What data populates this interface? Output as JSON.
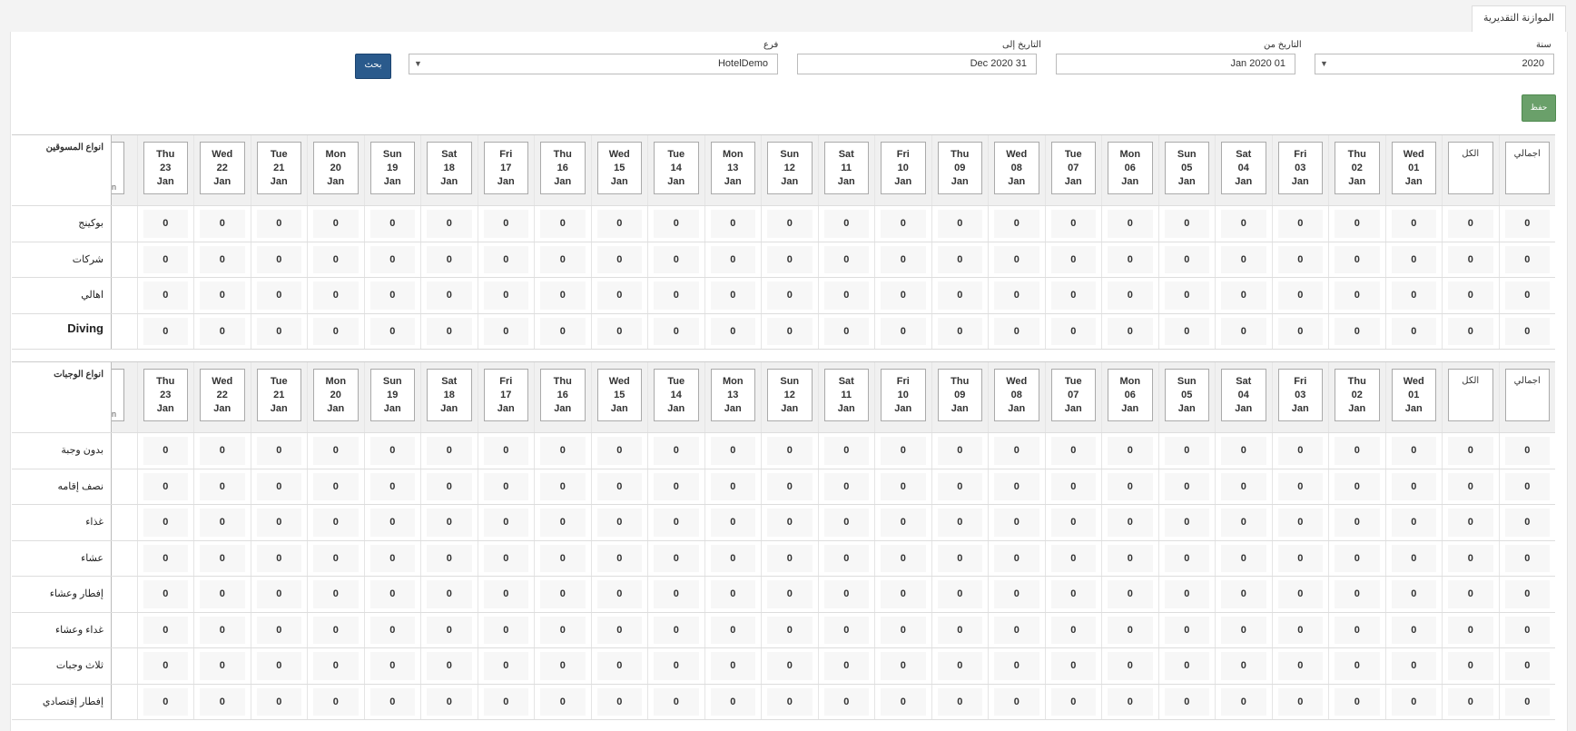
{
  "tab": {
    "title": "الموازنة التقديرية"
  },
  "filters": {
    "year": {
      "label": "سنة",
      "value": "2020"
    },
    "date_from": {
      "label": "التاريخ من",
      "value": "Jan 2020 01"
    },
    "date_to": {
      "label": "التاريخ إلى",
      "value": "Dec 2020 31"
    },
    "branch": {
      "label": "فرع",
      "value": "HotelDemo"
    },
    "search_label": "بحث"
  },
  "save_label": "حفظ",
  "columns": {
    "total": "اجمالي",
    "all": "الكل",
    "days": [
      {
        "dow": "Wed",
        "day": "01",
        "mon": "Jan"
      },
      {
        "dow": "Thu",
        "day": "02",
        "mon": "Jan"
      },
      {
        "dow": "Fri",
        "day": "03",
        "mon": "Jan"
      },
      {
        "dow": "Sat",
        "day": "04",
        "mon": "Jan"
      },
      {
        "dow": "Sun",
        "day": "05",
        "mon": "Jan"
      },
      {
        "dow": "Mon",
        "day": "06",
        "mon": "Jan"
      },
      {
        "dow": "Tue",
        "day": "07",
        "mon": "Jan"
      },
      {
        "dow": "Wed",
        "day": "08",
        "mon": "Jan"
      },
      {
        "dow": "Thu",
        "day": "09",
        "mon": "Jan"
      },
      {
        "dow": "Fri",
        "day": "10",
        "mon": "Jan"
      },
      {
        "dow": "Sat",
        "day": "11",
        "mon": "Jan"
      },
      {
        "dow": "Sun",
        "day": "12",
        "mon": "Jan"
      },
      {
        "dow": "Mon",
        "day": "13",
        "mon": "Jan"
      },
      {
        "dow": "Tue",
        "day": "14",
        "mon": "Jan"
      },
      {
        "dow": "Wed",
        "day": "15",
        "mon": "Jan"
      },
      {
        "dow": "Thu",
        "day": "16",
        "mon": "Jan"
      },
      {
        "dow": "Fri",
        "day": "17",
        "mon": "Jan"
      },
      {
        "dow": "Sat",
        "day": "18",
        "mon": "Jan"
      },
      {
        "dow": "Sun",
        "day": "19",
        "mon": "Jan"
      },
      {
        "dow": "Mon",
        "day": "20",
        "mon": "Jan"
      },
      {
        "dow": "Tue",
        "day": "21",
        "mon": "Jan"
      },
      {
        "dow": "Wed",
        "day": "22",
        "mon": "Jan"
      },
      {
        "dow": "Thu",
        "day": "23",
        "mon": "Jan"
      }
    ],
    "partial_fragment": "n"
  },
  "groups": [
    {
      "title": "انواع المسوقين",
      "rows": [
        {
          "label": "بوكينج",
          "en": false
        },
        {
          "label": "شركات",
          "en": false
        },
        {
          "label": "اهالي",
          "en": false
        },
        {
          "label": "Diving",
          "en": true
        }
      ]
    },
    {
      "title": "انواع الوجبات",
      "rows": [
        {
          "label": "بدون وجبة",
          "en": false
        },
        {
          "label": "نصف إقامه",
          "en": false
        },
        {
          "label": "غذاء",
          "en": false
        },
        {
          "label": "عشاء",
          "en": false
        },
        {
          "label": "إفطار وعشاء",
          "en": false
        },
        {
          "label": "غداء وعشاء",
          "en": false
        },
        {
          "label": "ثلاث وجبات",
          "en": false
        },
        {
          "label": "إفطار إقتصادي",
          "en": false
        }
      ]
    }
  ],
  "cell_value": "0"
}
